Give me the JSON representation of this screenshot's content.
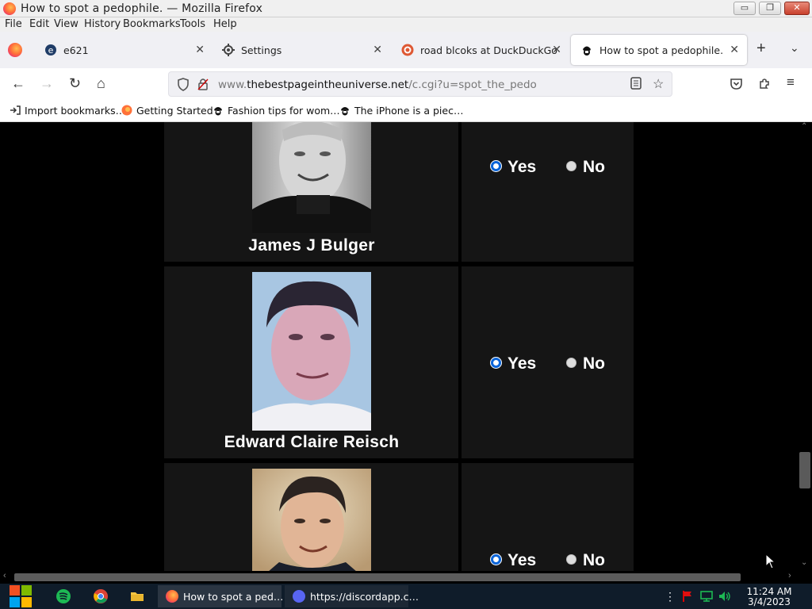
{
  "window": {
    "title": "How to spot a pedophile. — Mozilla Firefox",
    "minimize_label": "▭",
    "restore_label": "❐",
    "close_label": "✕"
  },
  "menu": [
    "File",
    "Edit",
    "View",
    "History",
    "Bookmarks",
    "Tools",
    "Help"
  ],
  "tabs": [
    {
      "label": "e621",
      "icon": "e621-icon",
      "active": false
    },
    {
      "label": "Settings",
      "icon": "gear-icon",
      "active": false
    },
    {
      "label": "road blcoks at DuckDuckGo",
      "icon": "duckduckgo-icon",
      "active": false
    },
    {
      "label": "How to spot a pedophile.",
      "icon": "che-icon",
      "active": true
    }
  ],
  "toolbar": {
    "new_tab": "+",
    "tab_list": "⌄",
    "back": "←",
    "forward": "→",
    "reload": "↻",
    "home": "⌂"
  },
  "address": {
    "prefix": "www.",
    "domain": "thebestpageintheuniverse.net",
    "path": "/c.cgi?u=spot_the_pedo"
  },
  "bookmarks": [
    {
      "label": "Import bookmarks…",
      "icon": "import-icon"
    },
    {
      "label": "Getting Started",
      "icon": "firefox-icon"
    },
    {
      "label": "Fashion tips for wom…",
      "icon": "che-icon"
    },
    {
      "label": "The iPhone is a piec…",
      "icon": "che-icon"
    }
  ],
  "people": [
    {
      "name": "James J Bulger",
      "yes": "Yes",
      "no": "No",
      "selected": "yes"
    },
    {
      "name": "Edward Claire Reisch",
      "yes": "Yes",
      "no": "No",
      "selected": "yes"
    },
    {
      "name": "",
      "yes": "Yes",
      "no": "No",
      "selected": "yes"
    }
  ],
  "taskbar": {
    "tasks": [
      {
        "label": "How to spot a ped…",
        "icon": "firefox-icon"
      },
      {
        "label": "https://discordapp.c…",
        "icon": "discord-icon"
      }
    ],
    "time": "11:24 AM",
    "date": "3/4/2023"
  }
}
